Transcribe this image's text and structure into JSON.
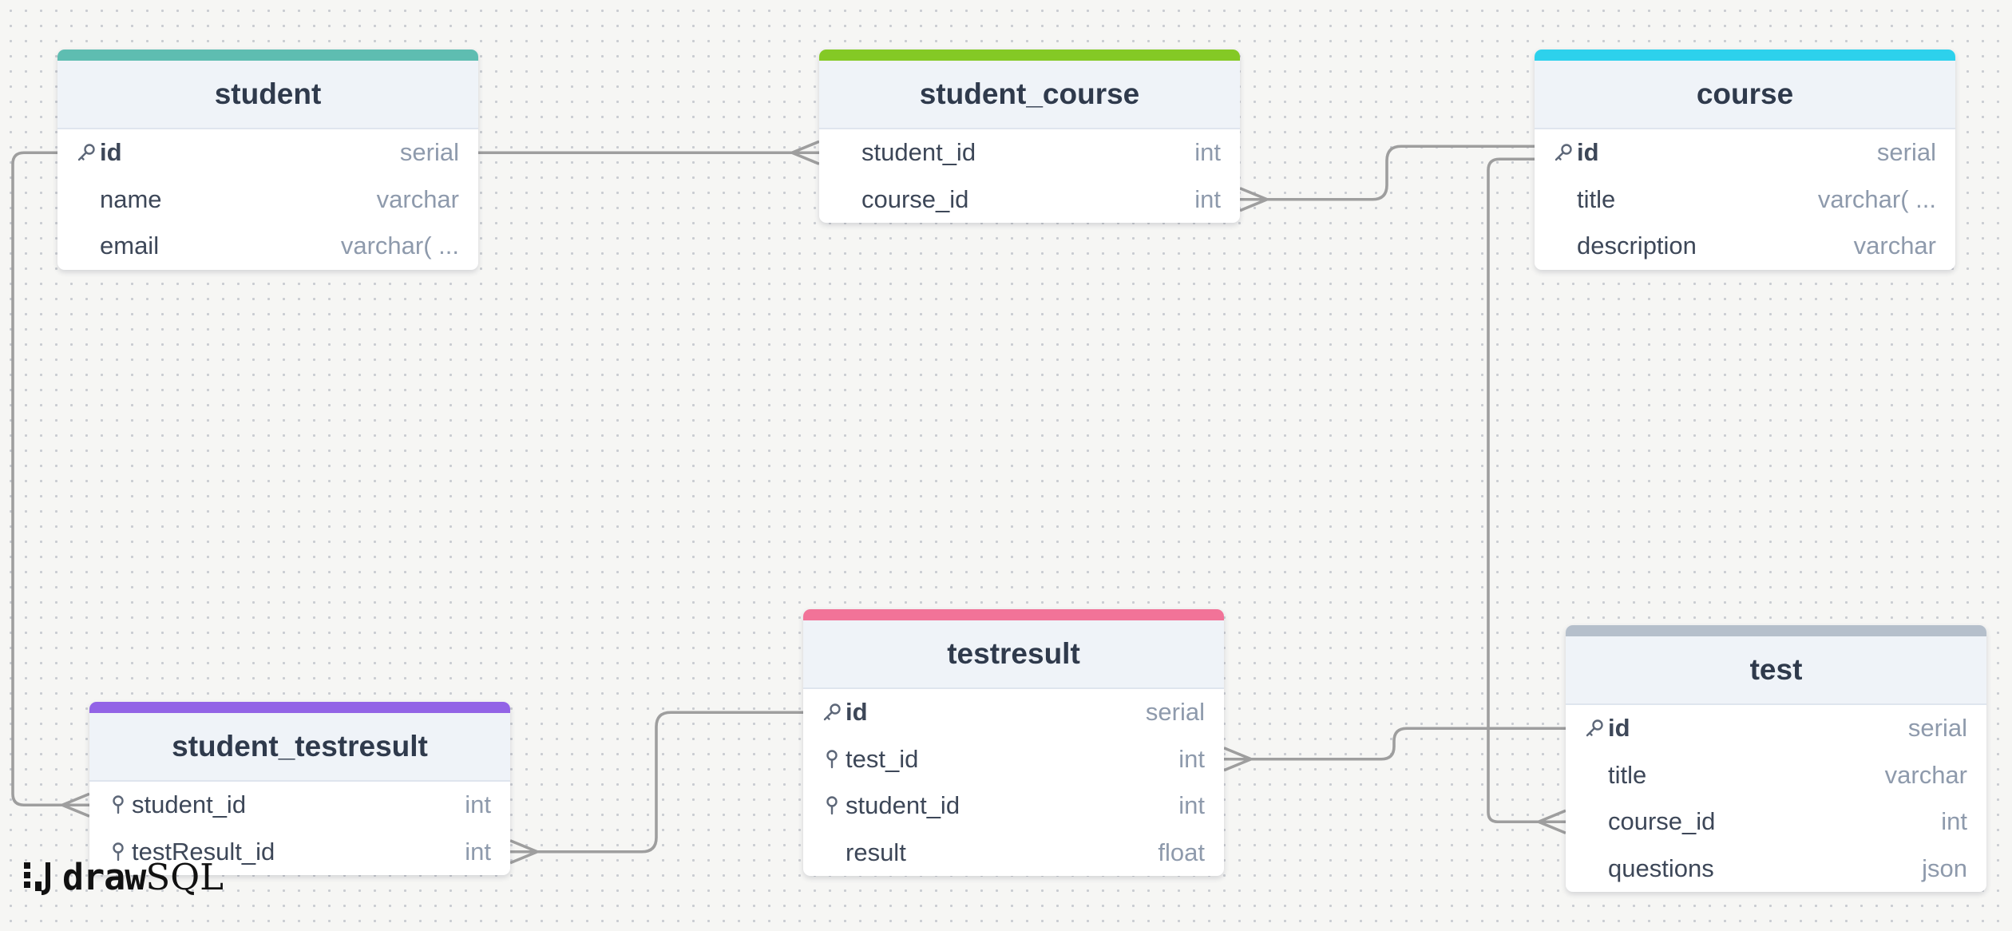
{
  "tables": [
    {
      "name": "student",
      "color": "#5ebdb1",
      "columns": [
        {
          "name": "id",
          "type": "serial",
          "key": "pk"
        },
        {
          "name": "name",
          "type": "varchar",
          "key": ""
        },
        {
          "name": "email",
          "type": "varchar( ...",
          "key": ""
        }
      ]
    },
    {
      "name": "student_course",
      "color": "#84c925",
      "columns": [
        {
          "name": "student_id",
          "type": "int",
          "key": ""
        },
        {
          "name": "course_id",
          "type": "int",
          "key": ""
        }
      ]
    },
    {
      "name": "course",
      "color": "#2dd1ec",
      "columns": [
        {
          "name": "id",
          "type": "serial",
          "key": "pk"
        },
        {
          "name": "title",
          "type": "varchar( ...",
          "key": ""
        },
        {
          "name": "description",
          "type": "varchar",
          "key": ""
        }
      ]
    },
    {
      "name": "testresult",
      "color": "#f27398",
      "columns": [
        {
          "name": "id",
          "type": "serial",
          "key": "pk"
        },
        {
          "name": "test_id",
          "type": "int",
          "key": "fk"
        },
        {
          "name": "student_id",
          "type": "int",
          "key": "fk"
        },
        {
          "name": "result",
          "type": "float",
          "key": ""
        }
      ]
    },
    {
      "name": "test",
      "color": "#b5bfcb",
      "columns": [
        {
          "name": "id",
          "type": "serial",
          "key": "pk"
        },
        {
          "name": "title",
          "type": "varchar",
          "key": ""
        },
        {
          "name": "course_id",
          "type": "int",
          "key": ""
        },
        {
          "name": "questions",
          "type": "json",
          "key": ""
        }
      ]
    },
    {
      "name": "student_testresult",
      "color": "#9263e6",
      "columns": [
        {
          "name": "student_id",
          "type": "int",
          "key": "fk"
        },
        {
          "name": "testResult_id",
          "type": "int",
          "key": "fk"
        }
      ]
    }
  ],
  "relationships": [
    {
      "from": "student.id",
      "to": "student_course.student_id",
      "cardinality": "one-to-many"
    },
    {
      "from": "course.id",
      "to": "student_course.course_id",
      "cardinality": "one-to-many"
    },
    {
      "from": "course.id",
      "to": "test.course_id",
      "cardinality": "one-to-many"
    },
    {
      "from": "student.id",
      "to": "student_testresult.student_id",
      "cardinality": "one-to-many"
    },
    {
      "from": "testresult.id",
      "to": "student_testresult.testResult_id",
      "cardinality": "one-to-many"
    },
    {
      "from": "test.id",
      "to": "testresult.test_id",
      "cardinality": "one-to-many"
    }
  ],
  "branding": {
    "logo_draw": "draw",
    "logo_sql": "SQL"
  }
}
